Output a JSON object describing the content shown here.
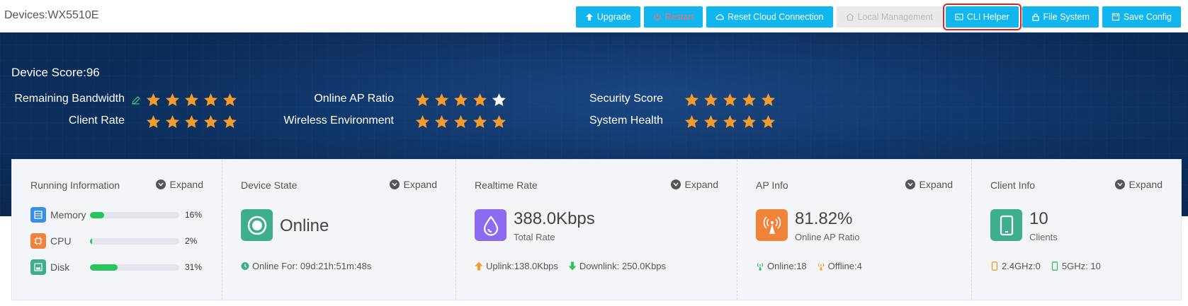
{
  "header": {
    "device_title": "Devices:WX5510E",
    "buttons": {
      "upgrade": "Upgrade",
      "restart": "Restart",
      "reset_cloud": "Reset Cloud Connection",
      "local_management": "Local Management",
      "cli_helper": "CLI Helper",
      "file_system": "File System",
      "save_config": "Save Config"
    }
  },
  "banner": {
    "score": "Device Score:96",
    "metrics": {
      "remaining_bandwidth": {
        "label": "Remaining Bandwidth",
        "stars": 5
      },
      "client_rate": {
        "label": "Client Rate",
        "stars": 5
      },
      "online_ap_ratio": {
        "label": "Online AP Ratio",
        "stars": 4
      },
      "wireless_environment": {
        "label": "Wireless Environment",
        "stars": 5
      },
      "security_score": {
        "label": "Security Score",
        "stars": 5
      },
      "system_health": {
        "label": "System Health",
        "stars": 5
      }
    },
    "star_color": "#f39c2b",
    "empty_star_color": "#ffffff"
  },
  "cards": {
    "expand_label": "Expand",
    "running": {
      "title": "Running Information",
      "memory": {
        "label": "Memory",
        "pct_text": "16%",
        "pct": 16
      },
      "cpu": {
        "label": "CPU",
        "pct_text": "2%",
        "pct": 2
      },
      "disk": {
        "label": "Disk",
        "pct_text": "31%",
        "pct": 31
      }
    },
    "device_state": {
      "title": "Device State",
      "value": "Online",
      "online_for": "Online For: 09d:21h:51m:48s"
    },
    "realtime_rate": {
      "title": "Realtime Rate",
      "value": "388.0Kbps",
      "sub": "Total Rate",
      "uplink": "Uplink:138.0Kbps",
      "downlink": "Downlink: 250.0Kbps"
    },
    "ap_info": {
      "title": "AP Info",
      "value": "81.82%",
      "sub": "Online AP Ratio",
      "online": "Online:18",
      "offline": "Offline:4"
    },
    "client_info": {
      "title": "Client Info",
      "value": "10",
      "sub": "Clients",
      "band_24": "2.4GHz:0",
      "band_5": "5GHz: 10"
    }
  },
  "colors": {
    "toolbar_button": "#11b6ef",
    "highlight_outline": "#e21f26",
    "progress_fill": "#2bc35b",
    "device_state_icon": "#3fae8e",
    "realtime_icon": "#8b6cf0",
    "ap_icon": "#f0823a",
    "client_icon": "#3fae8e"
  }
}
